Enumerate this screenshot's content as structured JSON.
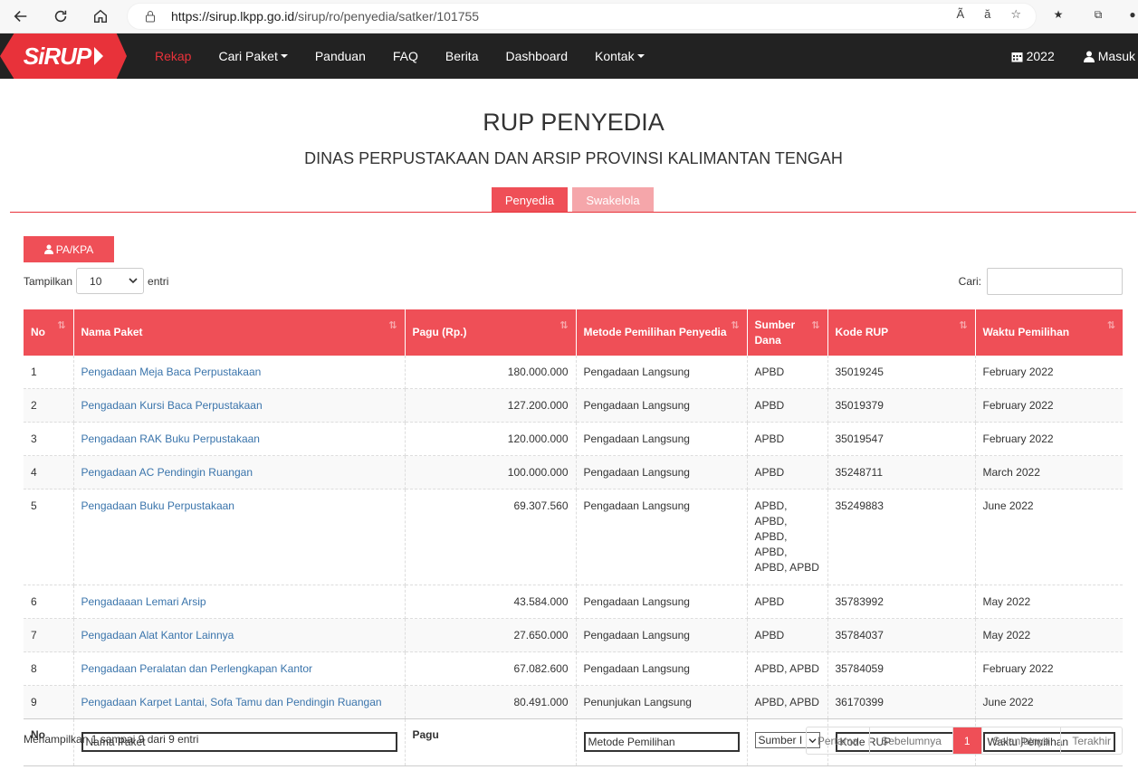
{
  "browser": {
    "url_host": "https://sirup.lkpp.go.id",
    "url_path": "/sirup/ro/penyedia/satker/101755"
  },
  "navbar": {
    "logo": "SiRUP",
    "items": [
      {
        "label": "Rekap"
      },
      {
        "label": "Cari Paket"
      },
      {
        "label": "Panduan"
      },
      {
        "label": "FAQ"
      },
      {
        "label": "Berita"
      },
      {
        "label": "Dashboard"
      },
      {
        "label": "Kontak"
      }
    ],
    "year": "2022",
    "login": "Masuk"
  },
  "page": {
    "title": "RUP PENYEDIA",
    "subtitle": "DINAS PERPUSTAKAAN DAN ARSIP PROVINSI KALIMANTAN TENGAH",
    "tab_penyedia": "Penyedia",
    "tab_swakelola": "Swakelola",
    "pakpa_button": "PA/KPA",
    "show_label": "Tampilkan",
    "show_value": "10",
    "show_suffix": "entri",
    "search_label": "Cari:"
  },
  "table": {
    "headers": {
      "no": "No",
      "nama": "Nama Paket",
      "pagu": "Pagu (Rp.)",
      "metode": "Metode Pemilihan Penyedia",
      "sumber": "Sumber Dana",
      "kode": "Kode RUP",
      "waktu": "Waktu Pemilihan"
    },
    "rows": [
      {
        "no": "1",
        "nama": "Pengadaan Meja Baca Perpustakaan",
        "pagu": "180.000.000",
        "metode": "Pengadaan Langsung",
        "sumber": "APBD",
        "kode": "35019245",
        "waktu": "February 2022"
      },
      {
        "no": "2",
        "nama": "Pengadaan Kursi Baca Perpustakaan",
        "pagu": "127.200.000",
        "metode": "Pengadaan Langsung",
        "sumber": "APBD",
        "kode": "35019379",
        "waktu": "February 2022"
      },
      {
        "no": "3",
        "nama": "Pengadaan RAK Buku Perpustakaan",
        "pagu": "120.000.000",
        "metode": "Pengadaan Langsung",
        "sumber": "APBD",
        "kode": "35019547",
        "waktu": "February 2022"
      },
      {
        "no": "4",
        "nama": "Pengadaan AC Pendingin Ruangan",
        "pagu": "100.000.000",
        "metode": "Pengadaan Langsung",
        "sumber": "APBD",
        "kode": "35248711",
        "waktu": "March 2022"
      },
      {
        "no": "5",
        "nama": "Pengadaan Buku Perpustakaan",
        "pagu": "69.307.560",
        "metode": "Pengadaan Langsung",
        "sumber": "APBD, APBD, APBD, APBD, APBD, APBD",
        "kode": "35249883",
        "waktu": "June 2022"
      },
      {
        "no": "6",
        "nama": "Pengadaaan Lemari Arsip",
        "pagu": "43.584.000",
        "metode": "Pengadaan Langsung",
        "sumber": "APBD",
        "kode": "35783992",
        "waktu": "May 2022"
      },
      {
        "no": "7",
        "nama": "Pengadaan Alat Kantor Lainnya",
        "pagu": "27.650.000",
        "metode": "Pengadaan Langsung",
        "sumber": "APBD",
        "kode": "35784037",
        "waktu": "May 2022"
      },
      {
        "no": "8",
        "nama": "Pengadaan Peralatan dan Perlengkapan Kantor",
        "pagu": "67.082.600",
        "metode": "Pengadaan Langsung",
        "sumber": "APBD, APBD",
        "kode": "35784059",
        "waktu": "February 2022"
      },
      {
        "no": "9",
        "nama": "Pengadaan Karpet Lantai, Sofa Tamu dan Pendingin Ruangan",
        "pagu": "80.491.000",
        "metode": "Penunjukan Langsung",
        "sumber": "APBD, APBD",
        "kode": "36170399",
        "waktu": "June 2022"
      }
    ],
    "footer": {
      "no": "No",
      "nama_ph": "Nama Paket",
      "pagu": "Pagu",
      "metode_ph": "Metode Pemilihan",
      "sumber_ph": "Sumber I",
      "kode_ph": "Kode RUP",
      "waktu_ph": "Waktu Pemilihan"
    }
  },
  "pagination": {
    "info": "Menampilkan 1 sampai 9 dari 9 entri",
    "first": "Pertama",
    "prev": "Sebelumnya",
    "current": "1",
    "next": "Selanjutnya",
    "last": "Terakhir"
  }
}
